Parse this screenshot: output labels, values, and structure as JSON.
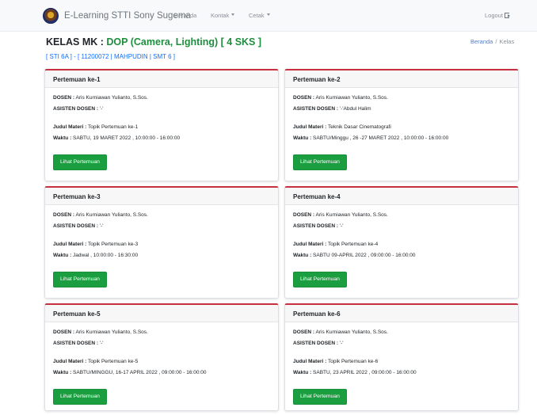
{
  "navbar": {
    "brand": "E-Learning STTI Sony Sugema",
    "links": [
      "Beranda",
      "Kontak",
      "Cetak"
    ],
    "logout": "Logout"
  },
  "header": {
    "title_prefix": "KELAS MK :",
    "title_course": "DOP (Camera, Lighting) [ 4 SKS ]",
    "subline": "[ STI 6A ] - [ 11200072 | MAHPUDIN | SMT 6 ]"
  },
  "breadcrumb": {
    "home": "Beranda",
    "sep": "/",
    "current": "Kelas"
  },
  "labels": {
    "dosen": "DOSEN :",
    "asisten": "ASISTEN DOSEN :",
    "judul": "Judul Materi :",
    "waktu": "Waktu :",
    "button": "Lihat Pertemuan"
  },
  "cards": [
    {
      "title": "Pertemuan ke-1",
      "dosen": "Aris Kurniawan Yulianto, S.Sos.",
      "asisten": "'-'",
      "judul": "Topik Pertemuan ke-1",
      "waktu": "SABTU, 19 MARET 2022 , 10:00:00 - 16:00:00"
    },
    {
      "title": "Pertemuan ke-2",
      "dosen": "Aris Kurniawan Yulianto, S.Sos.",
      "asisten": "'-'Abdul Halim",
      "judul": "Teknik Dasar Cinematografi",
      "waktu": "SABTU/Minggu , 26 -27 MARET 2022 , 10:00:00 - 16:00:00"
    },
    {
      "title": "Pertemuan ke-3",
      "dosen": "Aris Kurniawan Yulianto, S.Sos.",
      "asisten": "'-'",
      "judul": "Topik Pertemuan ke-3",
      "waktu": "Jadwal , 10:00:00 - 16:30:00"
    },
    {
      "title": "Pertemuan ke-4",
      "dosen": "Aris Kurniawan Yulianto, S.Sos.",
      "asisten": "'-'",
      "judul": "Topik Pertemuan ke-4",
      "waktu": "SABTU 09-APRIL 2022 , 09:00:00 - 16:00:00"
    },
    {
      "title": "Pertemuan ke-5",
      "dosen": "Aris Kurniawan Yulianto, S.Sos.",
      "asisten": "'-'",
      "judul": "Topik Pertemuan ke-5",
      "waktu": "SABTU/MINGGU, 16-17 APRIL 2022 , 09:00:00 - 16:00:00"
    },
    {
      "title": "Pertemuan ke-6",
      "dosen": "Aris Kurniawan Yulianto, S.Sos.",
      "asisten": "'-'",
      "judul": "Topik Pertemuan ke-6",
      "waktu": "SABTU, 23 APRIL 2022 , 09:00:00 - 16:00:00"
    }
  ],
  "colors": {
    "accent_green": "#1e8e3e",
    "button_green": "#1a9e3f",
    "card_top_border": "#c7313f",
    "link_blue": "#0d6efd"
  }
}
